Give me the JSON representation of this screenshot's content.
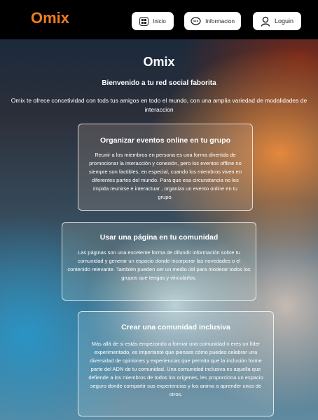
{
  "nav": {
    "brand": "Omix",
    "buttons": [
      {
        "label": "Inicio",
        "icon": "home-icon"
      },
      {
        "label": "Informacion",
        "icon": "chat-bubble-icon"
      },
      {
        "label": "Loguin",
        "icon": "user-icon"
      }
    ]
  },
  "hero": {
    "title": "Omix",
    "subtitle": "Bienvenido a tu red social faborita",
    "intro": "Omix te ofrece concetividad con tods tus amigos en todo el mundo, con una amplia variedad de modalidades de interaccion"
  },
  "cards": [
    {
      "title": "Organizar eventos online en tu grupo",
      "text": "Reunir a los miembros en persona es una forma divertida de promocionar la interacción y conexión, pero los eventos offline no siempre son factibles, en especial, cuando los miembros viven en diferentes partes del mundo. Para que esa circunstancia no les impida reunirse e interactuar , organiza un evento online en tu grupo."
    },
    {
      "title": "Usar una página en tu comunidad",
      "text": "Las páginas son una excelente forma de difundir información sobre tu comunidad y generar un espacio donde incorporar las novedades o el contenido relevante. También pueden ser un medio útil para moderar todos los grupos que tengas y vincularlos."
    },
    {
      "title": "Crear una comunidad inclusiva",
      "text": "Más allá de si estás empezando a formar una comunidad o eres un líder experimentado, es importante que pienses cómo puedes celebrar una diversidad de opiniones y experiencias que permita que la inclusión forme parte del ADN de tu comunidad. Una comunidad inclusiva es aquella que defiende a los miembros de todos los orígenes, les proporciona un espacio seguro donde compartir sus experiencias y los anima a aprender unos de otros."
    }
  ],
  "colors": {
    "brand": "#f07c1e",
    "topbar": "#000000"
  }
}
